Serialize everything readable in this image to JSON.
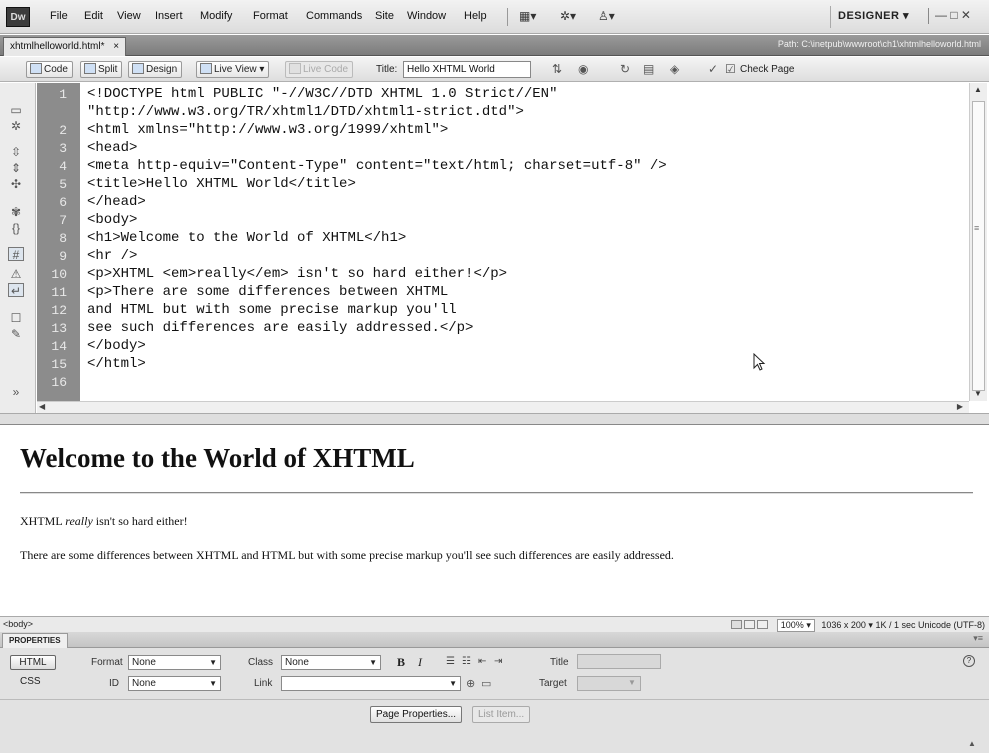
{
  "app": {
    "logo": "Dw",
    "menu": [
      "File",
      "Edit",
      "View",
      "Insert",
      "Modify",
      "Format",
      "Commands",
      "Site",
      "Window",
      "Help"
    ],
    "workspace": "DESIGNER",
    "workspace_arrow": "▾",
    "window_controls": "— □ ✕"
  },
  "document": {
    "tab_label": "xhtmlhelloworld.html*",
    "tab_close": "×",
    "path": "Path: C:\\inetpub\\wwwroot\\ch1\\xhtmlhelloworld.html"
  },
  "toolbar": {
    "code": "Code",
    "split": "Split",
    "design": "Design",
    "live_view": "Live View",
    "live_code": "Live Code",
    "title_label": "Title:",
    "title_value": "Hello XHTML World",
    "check_page": "Check Page"
  },
  "code": {
    "line_numbers": [
      "1",
      "",
      "2",
      "3",
      "4",
      "5",
      "6",
      "7",
      "8",
      "9",
      "10",
      "11",
      "12",
      "13",
      "14",
      "15",
      "16"
    ],
    "lines": [
      "<!DOCTYPE html PUBLIC \"-//W3C//DTD XHTML 1.0 Strict//EN\"",
      "\"http://www.w3.org/TR/xhtml1/DTD/xhtml1-strict.dtd\">",
      "<html xmlns=\"http://www.w3.org/1999/xhtml\">",
      "<head>",
      "<meta http-equiv=\"Content-Type\" content=\"text/html; charset=utf-8\" />",
      "<title>Hello XHTML World</title>",
      "</head>",
      "<body>",
      "<h1>Welcome to the World of XHTML</h1>",
      "<hr />",
      "<p>XHTML <em>really</em> isn't so hard either!</p>",
      "<p>There are some differences between XHTML",
      "and HTML but with some precise markup you'll",
      "see such differences are easily addressed.</p>",
      "</body>",
      "</html>",
      ""
    ]
  },
  "design": {
    "h1": "Welcome to the World of XHTML",
    "p1_before": "XHTML ",
    "p1_em": "really",
    "p1_after": " isn't so hard either!",
    "p2": "There are some differences between XHTML and HTML but with some precise markup you'll see such differences are easily addressed."
  },
  "status": {
    "tag": "<body>",
    "zoom": "100%",
    "window_size": "1036 x 200",
    "download": "1K / 1 sec",
    "encoding": "Unicode (UTF-8)"
  },
  "properties": {
    "panel_title": "PROPERTIES",
    "html_button": "HTML",
    "css_button": "CSS",
    "format_label": "Format",
    "format_value": "None",
    "id_label": "ID",
    "id_value": "None",
    "class_label": "Class",
    "class_value": "None",
    "link_label": "Link",
    "link_value": "",
    "bold": "B",
    "italic": "I",
    "title_label": "Title",
    "target_label": "Target",
    "page_properties": "Page Properties...",
    "list_item": "List Item..."
  },
  "icons": {
    "toolbar": [
      "code-view-icon",
      "split-view-icon",
      "design-view-icon",
      "live-view-icon",
      "live-code-icon",
      "file-management-icon",
      "preview-browser-icon",
      "refresh-icon",
      "view-options-icon",
      "visual-aids-icon",
      "validate-icon",
      "check-page-icon"
    ],
    "coding": [
      "open-documents-icon",
      "show-code-navigator-icon",
      "collapse-tag-icon",
      "collapse-selection-icon",
      "expand-all-icon",
      "select-parent-tag-icon",
      "balance-braces-icon",
      "line-numbers-icon",
      "highlight-invalid-icon",
      "word-wrap-icon",
      "apply-comment-icon",
      "remove-comment-icon",
      "more-icon"
    ]
  }
}
